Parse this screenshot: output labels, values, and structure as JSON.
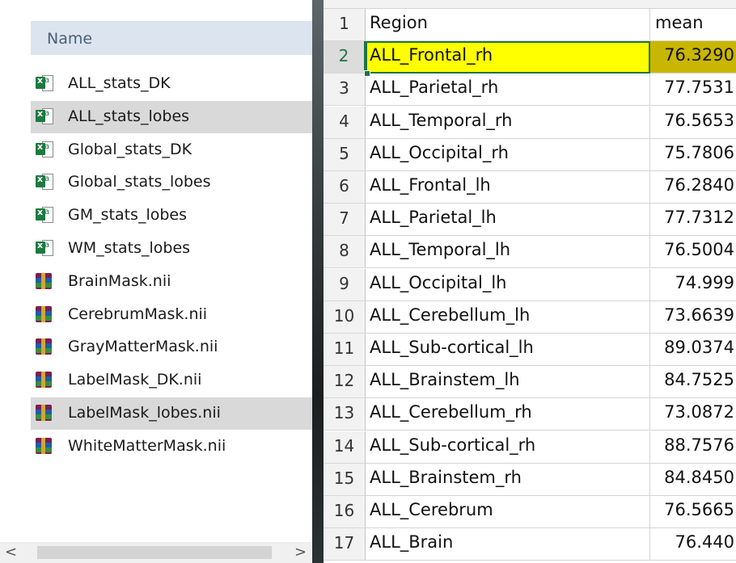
{
  "explorer": {
    "column_header": "Name",
    "files": [
      {
        "name": "ALL_stats_DK",
        "icon": "excel-file-icon",
        "selected": false
      },
      {
        "name": "ALL_stats_lobes",
        "icon": "excel-file-icon",
        "selected": true
      },
      {
        "name": "Global_stats_DK",
        "icon": "excel-file-icon",
        "selected": false
      },
      {
        "name": "Global_stats_lobes",
        "icon": "excel-file-icon",
        "selected": false
      },
      {
        "name": "GM_stats_lobes",
        "icon": "excel-file-icon",
        "selected": false
      },
      {
        "name": "WM_stats_lobes",
        "icon": "excel-file-icon",
        "selected": false
      },
      {
        "name": "BrainMask.nii",
        "icon": "archive-file-icon",
        "selected": false
      },
      {
        "name": "CerebrumMask.nii",
        "icon": "archive-file-icon",
        "selected": false
      },
      {
        "name": "GrayMatterMask.nii",
        "icon": "archive-file-icon",
        "selected": false
      },
      {
        "name": "LabelMask_DK.nii",
        "icon": "archive-file-icon",
        "selected": false
      },
      {
        "name": "LabelMask_lobes.nii",
        "icon": "archive-file-icon",
        "selected": true
      },
      {
        "name": "WhiteMatterMask.nii",
        "icon": "archive-file-icon",
        "selected": false
      }
    ],
    "scroll_left": "<",
    "scroll_right": ">"
  },
  "sheet": {
    "header": {
      "row": "1",
      "a": "Region",
      "b": "mean"
    },
    "rows": [
      {
        "row": "2",
        "a": "ALL_Frontal_rh",
        "b": "76.3290"
      },
      {
        "row": "3",
        "a": "ALL_Parietal_rh",
        "b": "77.7531"
      },
      {
        "row": "4",
        "a": "ALL_Temporal_rh",
        "b": "76.5653"
      },
      {
        "row": "5",
        "a": "ALL_Occipital_rh",
        "b": "75.7806"
      },
      {
        "row": "6",
        "a": "ALL_Frontal_lh",
        "b": "76.2840"
      },
      {
        "row": "7",
        "a": "ALL_Parietal_lh",
        "b": "77.7312"
      },
      {
        "row": "8",
        "a": "ALL_Temporal_lh",
        "b": "76.5004"
      },
      {
        "row": "9",
        "a": "ALL_Occipital_lh",
        "b": "74.999"
      },
      {
        "row": "10",
        "a": "ALL_Cerebellum_lh",
        "b": "73.6639"
      },
      {
        "row": "11",
        "a": "ALL_Sub-cortical_lh",
        "b": "89.0374"
      },
      {
        "row": "12",
        "a": "ALL_Brainstem_lh",
        "b": "84.7525"
      },
      {
        "row": "13",
        "a": "ALL_Cerebellum_rh",
        "b": "73.0872"
      },
      {
        "row": "14",
        "a": "ALL_Sub-cortical_rh",
        "b": "88.7576"
      },
      {
        "row": "15",
        "a": "ALL_Brainstem_rh",
        "b": "84.8450"
      },
      {
        "row": "16",
        "a": "ALL_Cerebrum",
        "b": "76.5665"
      },
      {
        "row": "17",
        "a": "ALL_Brain",
        "b": "76.440"
      }
    ],
    "active_row": "2",
    "colors": {
      "highlight": "#ffff00",
      "highlight_b": "#c9b600",
      "selection": "#217346"
    }
  }
}
